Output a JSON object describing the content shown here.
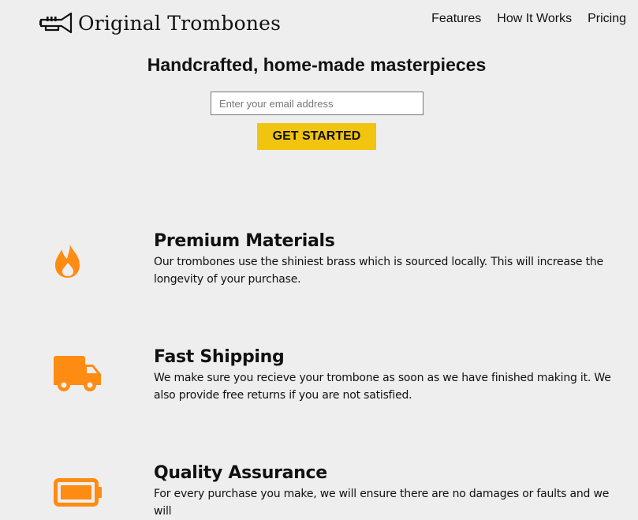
{
  "header": {
    "logo_text": "Original Trombones",
    "nav": [
      {
        "label": "Features"
      },
      {
        "label": "How It Works"
      },
      {
        "label": "Pricing"
      }
    ]
  },
  "hero": {
    "title": "Handcrafted, home-made masterpieces",
    "email_placeholder": "Enter your email address",
    "cta_label": "GET STARTED"
  },
  "features": [
    {
      "icon": "fire-icon",
      "title": "Premium Materials",
      "text": "Our trombones use the shiniest brass which is sourced locally. This will increase the longevity of your purchase."
    },
    {
      "icon": "truck-icon",
      "title": "Fast Shipping",
      "text": "We make sure you recieve your trombone as soon as we have finished making it. We also provide free returns if you are not satisfied."
    },
    {
      "icon": "battery-icon",
      "title": "Quality Assurance",
      "text": "For every purchase you make, we will ensure there are no damages or faults and we will"
    }
  ],
  "colors": {
    "background": "#eeeeee",
    "accent": "#f1c40f",
    "icon": "#ff8c12"
  }
}
